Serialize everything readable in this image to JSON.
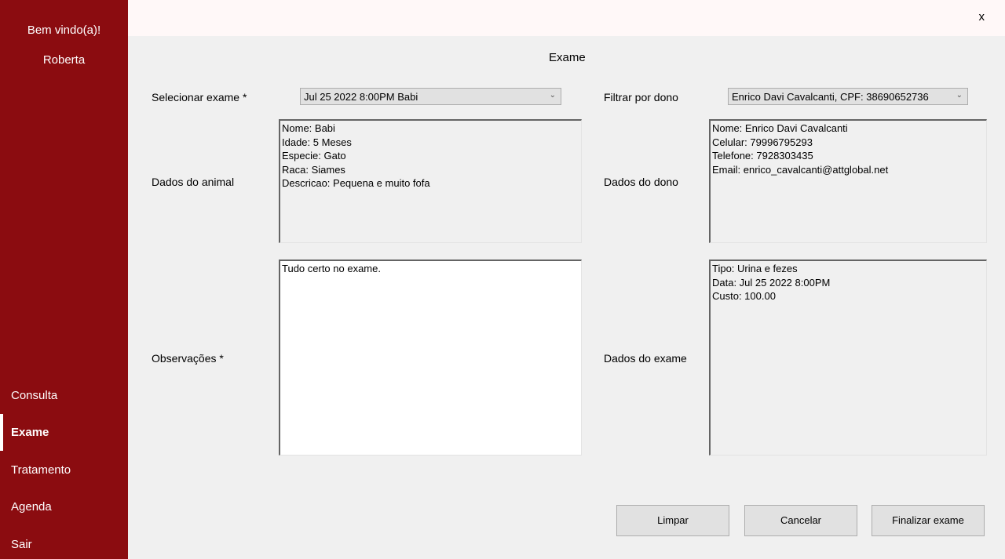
{
  "sidebar": {
    "welcome": "Bem vindo(a)!",
    "user": "Roberta",
    "items": [
      {
        "label": "Consulta"
      },
      {
        "label": "Exame",
        "active": true
      },
      {
        "label": "Tratamento"
      },
      {
        "label": "Agenda"
      },
      {
        "label": "Sair"
      }
    ],
    "background_color": "#8b0c10"
  },
  "window": {
    "close_label": "x"
  },
  "form": {
    "title": "Exame",
    "select_exam_label": "Selecionar exame *",
    "select_exam_value": "Jul 25 2022  8:00PM Babi",
    "filter_owner_label": "Filtrar por dono",
    "filter_owner_value": "Enrico Davi Cavalcanti, CPF: 38690652736",
    "animal_label": "Dados do animal",
    "animal_lines": [
      "Nome: Babi",
      "Idade: 5 Meses",
      "Especie: Gato",
      "Raca: Siames",
      "Descricao: Pequena e muito fofa"
    ],
    "owner_label": "Dados do dono",
    "owner_lines": [
      "Nome: Enrico Davi Cavalcanti",
      "Celular: 79996795293",
      "Telefone: 7928303435",
      "Email: enrico_cavalcanti@attglobal.net"
    ],
    "observations_label": "Observações *",
    "observations_value": "Tudo certo no exame.",
    "exam_label": "Dados do exame",
    "exam_lines": [
      "Tipo: Urina e fezes",
      "Data: Jul 25 2022  8:00PM",
      "Custo: 100.00"
    ]
  },
  "buttons": {
    "clear": "Limpar",
    "cancel": "Cancelar",
    "finish": "Finalizar exame"
  }
}
